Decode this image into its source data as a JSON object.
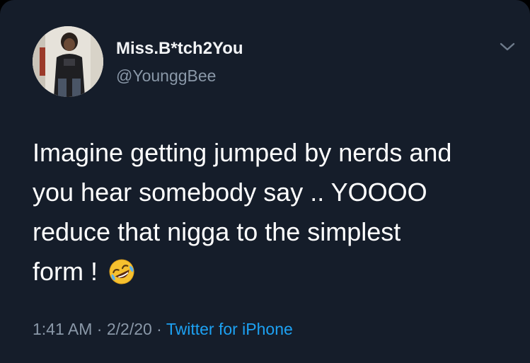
{
  "tweet": {
    "display_name": "Miss.B*tch2You",
    "handle": "@YounggBee",
    "text_lines": [
      "Imagine getting jumped by nerds and",
      "you hear somebody say .. YOOOO",
      "reduce that nigga to the simplest",
      "form !"
    ],
    "emoji": "rolling-on-the-floor-laughing-emoji",
    "time": "1:41 AM",
    "separator": " · ",
    "date": "2/2/20",
    "source": "Twitter for iPhone"
  },
  "icons": {
    "menu": "chevron-down-icon"
  },
  "colors": {
    "background": "#151d2a",
    "primary_text": "#ffffff",
    "secondary_text": "#8a98a8",
    "link": "#1da1f2"
  }
}
